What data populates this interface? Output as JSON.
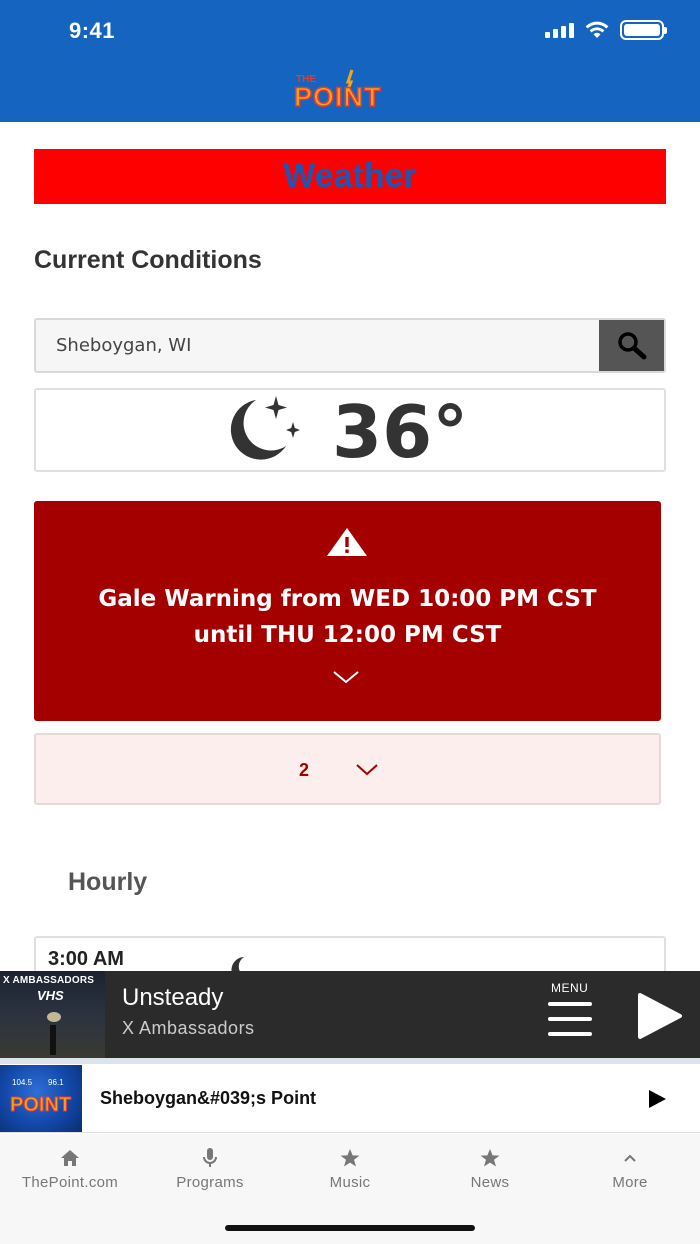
{
  "status_bar": {
    "time": "9:41"
  },
  "header": {
    "logo_small": "THE",
    "logo_main": "POINT"
  },
  "page": {
    "banner_title": "Weather",
    "section_title": "Current Conditions"
  },
  "search": {
    "value": "Sheboygan, WI",
    "placeholder": "Sheboygan, WI"
  },
  "current": {
    "temperature": "36°",
    "condition_icon": "moon-stars-icon"
  },
  "alert": {
    "line1": "Gale Warning from WED 10:00 PM CST",
    "line2": "until THU 12:00 PM CST",
    "more_count": "2"
  },
  "hourly": {
    "title": "Hourly",
    "first_time": "3:00 AM"
  },
  "player": {
    "album_artist": "X AMBASSADORS",
    "album_name": "VHS",
    "track": "Unsteady",
    "artist": "X Ambassadors",
    "menu_label": "MENU"
  },
  "station": {
    "name": "Sheboygan&#039;s Point",
    "logo_text": "POINT",
    "logo_freq1": "104.5",
    "logo_freq2": "96.1"
  },
  "nav": [
    {
      "label": "ThePoint.com",
      "icon": "home-icon"
    },
    {
      "label": "Programs",
      "icon": "microphone-icon"
    },
    {
      "label": "Music",
      "icon": "star-icon"
    },
    {
      "label": "News",
      "icon": "star-icon"
    },
    {
      "label": "More",
      "icon": "chevron-up-icon"
    }
  ],
  "colors": {
    "header_blue": "#1565c0",
    "banner_red": "#ff0000",
    "alert_red": "#a50000",
    "player_dark": "#2b2b2b"
  }
}
